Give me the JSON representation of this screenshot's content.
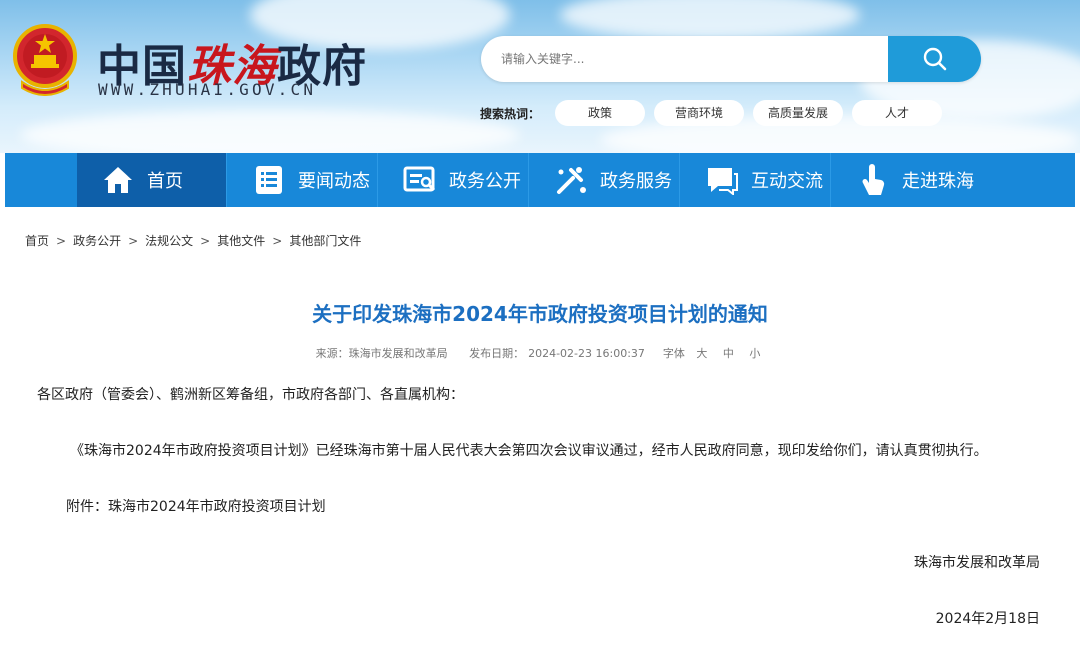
{
  "header": {
    "site_name_part1": "中国",
    "site_name_part2": "珠海",
    "site_name_part3": "政府",
    "site_url": "WWW.ZHUHAI.GOV.CN"
  },
  "search": {
    "placeholder": "请输入关键字...",
    "value": ""
  },
  "hot_search": {
    "label": "搜索热词：",
    "tags": [
      "政策",
      "营商环境",
      "高质量发展",
      "人才"
    ]
  },
  "nav": {
    "items": [
      {
        "label": "首页",
        "icon": "home-icon"
      },
      {
        "label": "要闻动态",
        "icon": "news-icon"
      },
      {
        "label": "政务公开",
        "icon": "disclosure-icon"
      },
      {
        "label": "政务服务",
        "icon": "service-icon"
      },
      {
        "label": "互动交流",
        "icon": "chat-icon"
      },
      {
        "label": "走进珠海",
        "icon": "pointer-icon"
      }
    ]
  },
  "breadcrumb": [
    "首页",
    "政务公开",
    "法规公文",
    "其他文件",
    "其他部门文件"
  ],
  "article": {
    "title": "关于印发珠海市2024年市政府投资项目计划的通知",
    "source_label": "来源：珠海市发展和改革局",
    "date_label": "发布日期：",
    "date_value": "2024-02-23 16:00:37",
    "font_label": "字体",
    "font_sizes": [
      "大",
      "中",
      "小"
    ],
    "salutation": "各区政府（管委会）、鹤洲新区筹备组，市政府各部门、各直属机构：",
    "body": "《珠海市2024年市政府投资项目计划》已经珠海市第十届人民代表大会第四次会议审议通过，经市人民政府同意，现印发给你们，请认真贯彻执行。",
    "attachment": "附件：珠海市2024年市政府投资项目计划",
    "signature": "珠海市发展和改革局",
    "sign_date": "2024年2月18日"
  },
  "colors": {
    "nav_bg": "#1888d9",
    "nav_active": "#0e5fa9",
    "title": "#1c6fc1",
    "search_button": "#1f9bd9"
  }
}
